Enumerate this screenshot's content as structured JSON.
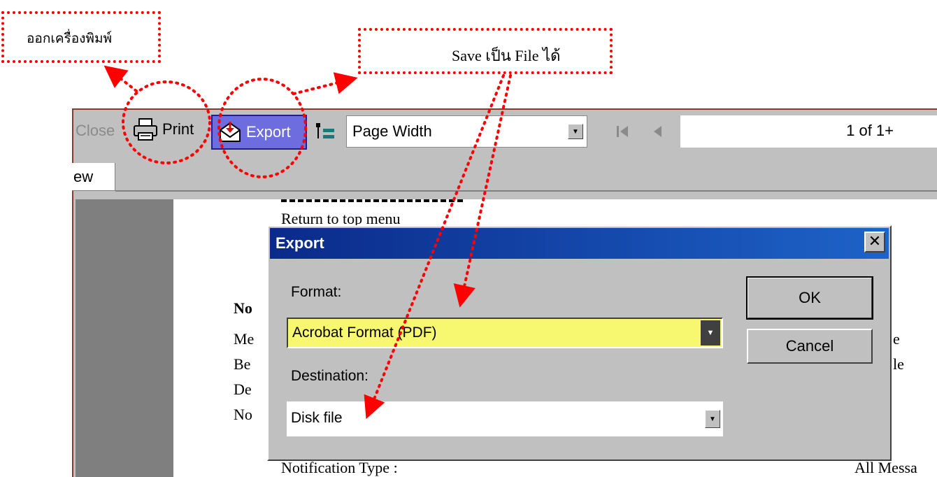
{
  "annotations": {
    "print_callout": "ออกเครื่องพิมพ์",
    "export_callout": "Save เป็น File ได้"
  },
  "toolbar": {
    "close_label": "Close",
    "print_label": "Print",
    "export_label": "Export",
    "zoom_value": "Page Width",
    "page_indicator": "1 of 1+"
  },
  "tab": {
    "label": "ew"
  },
  "report": {
    "line1": "Return to top menu",
    "heading": "No",
    "row1": "Me",
    "row2": "Be",
    "row3": "De",
    "row4": "No",
    "right1": "e",
    "right2": "le",
    "bottom_left": "Notification Type :",
    "bottom_right": "All Messa"
  },
  "dialog": {
    "title": "Export",
    "close_glyph": "✕",
    "format_label": "Format:",
    "format_value": "Acrobat Format (PDF)",
    "destination_label": "Destination:",
    "destination_value": "Disk file",
    "ok_label": "OK",
    "cancel_label": "Cancel"
  },
  "colors": {
    "annotation": "#ff0000",
    "title_bar_start": "#0a2a8a",
    "title_bar_end": "#1e63c8",
    "format_field": "#f8f870",
    "export_highlight": "#6d6de0"
  }
}
